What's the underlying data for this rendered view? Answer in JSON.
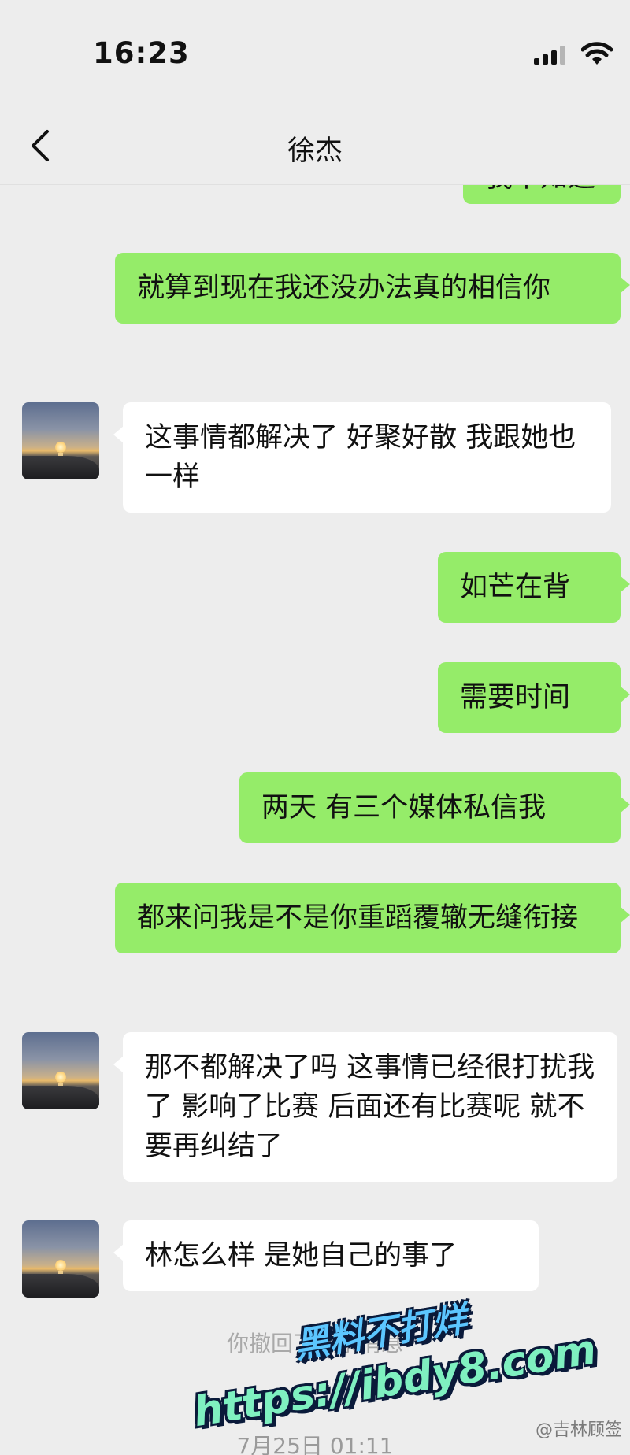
{
  "status_bar": {
    "time": "16:23"
  },
  "header": {
    "title": "徐杰"
  },
  "messages": [
    {
      "from": "me",
      "text": "我不知道"
    },
    {
      "from": "me",
      "text": "就算到现在我还没办法真的相信你"
    },
    {
      "from": "them",
      "text": "这事情都解决了 好聚好散 我跟她也一样"
    },
    {
      "from": "me",
      "text": "如芒在背"
    },
    {
      "from": "me",
      "text": "需要时间"
    },
    {
      "from": "me",
      "text": "两天 有三个媒体私信我"
    },
    {
      "from": "me",
      "text": "都来问我是不是你重蹈覆辙无缝衔接"
    },
    {
      "from": "them",
      "text": "那不都解决了吗 这事情已经很打扰我了 影响了比赛 后面还有比赛呢 就不要再纠结了"
    },
    {
      "from": "them",
      "text": "林怎么样 是她自己的事了"
    }
  ],
  "system_notice": "你撤回了一条消息",
  "timestamp": "7月25日 01:11",
  "watermark": {
    "line1": "黑料不打烊",
    "line2": "https://ibdy8.com"
  },
  "credit": "@吉林顾签",
  "colors": {
    "my_bubble": "#95ec69",
    "their_bubble": "#ffffff",
    "background": "#ededed"
  },
  "icons": {
    "back": "chevron-left-icon",
    "signal": "signal-icon",
    "wifi": "wifi-icon"
  }
}
